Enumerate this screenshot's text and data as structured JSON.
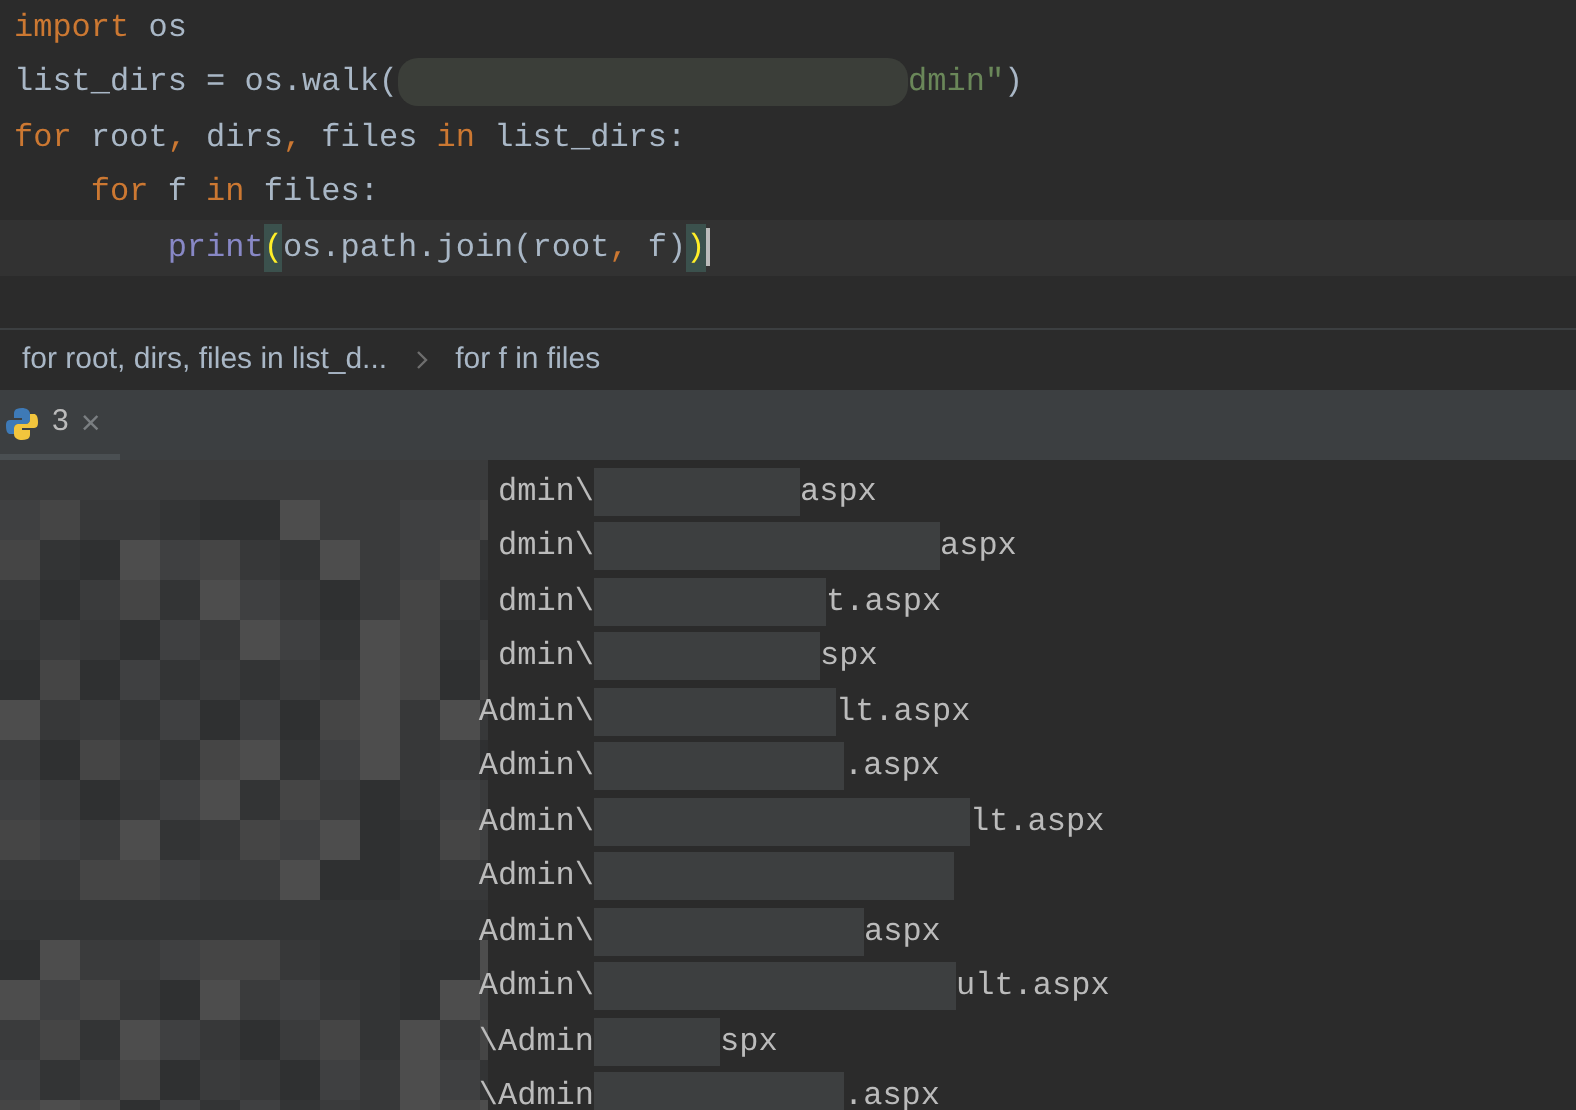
{
  "editor": {
    "lines": [
      {
        "current": false,
        "tokens": [
          {
            "text": "import",
            "kind": "keyword"
          },
          {
            "text": " os",
            "kind": "plain"
          }
        ]
      },
      {
        "current": false,
        "tokens": [
          {
            "text": "list_dirs = os.walk(",
            "kind": "plain"
          },
          {
            "kind": "redacted"
          },
          {
            "text": "dmin\"",
            "kind": "string"
          },
          {
            "text": ")",
            "kind": "plain"
          }
        ]
      },
      {
        "current": false,
        "tokens": [
          {
            "text": "for",
            "kind": "keyword"
          },
          {
            "text": " root",
            "kind": "plain"
          },
          {
            "text": ",",
            "kind": "keyword"
          },
          {
            "text": " dirs",
            "kind": "plain"
          },
          {
            "text": ",",
            "kind": "keyword"
          },
          {
            "text": " files ",
            "kind": "plain"
          },
          {
            "text": "in",
            "kind": "keyword"
          },
          {
            "text": " list_dirs:",
            "kind": "plain"
          }
        ]
      },
      {
        "current": false,
        "tokens": [
          {
            "text": "    for",
            "kind": "keyword"
          },
          {
            "text": " f ",
            "kind": "plain"
          },
          {
            "text": "in",
            "kind": "keyword"
          },
          {
            "text": " files:",
            "kind": "plain"
          }
        ]
      },
      {
        "current": true,
        "tokens": [
          {
            "text": "        print",
            "kind": "builtin"
          },
          {
            "text": "(",
            "kind": "bracket_match"
          },
          {
            "text": "os.path.join(root",
            "kind": "plain"
          },
          {
            "text": ",",
            "kind": "keyword"
          },
          {
            "text": " f)",
            "kind": "plain"
          },
          {
            "text": ")",
            "kind": "bracket_match"
          }
        ]
      }
    ]
  },
  "breadcrumbs": [
    "for root, dirs, files in list_d...",
    "for f in files"
  ],
  "run_tabs": [
    {
      "label": "3",
      "close": "×",
      "selected": true
    }
  ],
  "console": {
    "lines": [
      {
        "left": "dmin\\",
        "right": "aspx"
      },
      {
        "left": "dmin\\",
        "right": "aspx"
      },
      {
        "left": "dmin\\",
        "right": "t.aspx"
      },
      {
        "left": "dmin\\",
        "right": "spx"
      },
      {
        "left": "Admin\\",
        "right": "lt.aspx"
      },
      {
        "left": "Admin\\",
        "right": ".aspx"
      },
      {
        "left": "Admin\\",
        "right": "lt.aspx"
      },
      {
        "left": "Admin\\"
      },
      {
        "left": "Admin\\",
        "right": "aspx"
      },
      {
        "left": "Admin\\",
        "right": "ult.aspx"
      },
      {
        "left": "\\Admin",
        "right": "spx"
      },
      {
        "left": "\\Admin",
        "right": ".aspx"
      }
    ]
  }
}
